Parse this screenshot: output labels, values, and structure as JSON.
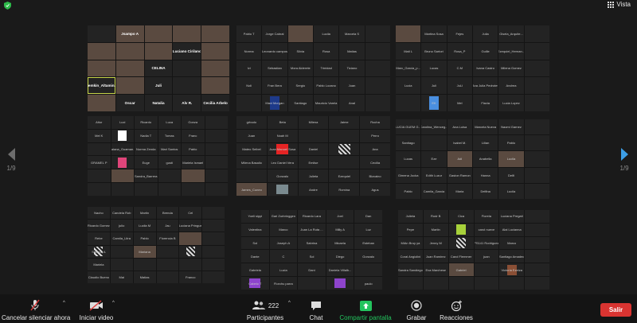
{
  "topbar": {
    "view_label": "Vista"
  },
  "nav": {
    "left_page": "1/9",
    "right_page": "1/9"
  },
  "colors": {
    "accent_blue": "#3d9ee6",
    "share_green": "#23c45e",
    "leave_red": "#d93431",
    "background": "#1a1a1a"
  },
  "panels": [
    {
      "cols": 5,
      "rows": 5,
      "cells": [
        "",
        "Jsampo A",
        "",
        "",
        "",
        "",
        "",
        "",
        "Luciano Cirilano",
        "",
        "",
        "",
        "CELINA",
        "",
        "",
        "Gemkin_Altamin...",
        "",
        "Juli",
        "",
        "",
        "",
        "Oscar",
        "Natalia",
        "Alv R.",
        "Cecilia Arbelo"
      ]
    },
    {
      "cols": 6,
      "rows": 5,
      "cells": [
        "Pablo T",
        "Jorge Cabral",
        "",
        "Lucila",
        "Marcela S",
        "",
        "Norma",
        "Leonardo campos",
        "Silvia",
        "Rosa",
        "Matias",
        "",
        "Ivi",
        "Sebastian",
        "Mora Alderete",
        "Trinidad",
        "Tiziano",
        "",
        "Noli",
        "Fran Bera",
        "Sergio",
        "Pablo Lozano",
        "Juan",
        "",
        "",
        "Maxi Morgan",
        "Santiago",
        "Mauricio Varela",
        "Anal",
        ""
      ]
    },
    {
      "cols": 6,
      "rows": 5,
      "cells": [
        "",
        "Martina Sosa",
        "Fejes",
        "Julia",
        "Gisela_Arquite...",
        "",
        "Mati L",
        "Bruno Sartori",
        "Rosa_P",
        "Guille",
        "Ezequiel_Hernan...",
        "",
        "Marc_Garcia_p...",
        "Lucas",
        "C.M",
        "Ivana Castro",
        "Milena Gomez",
        "",
        "Lucia",
        "Juli",
        "JuLi",
        "Ana Julia Pedrotes",
        "Andrea",
        "",
        "",
        "EK",
        "Mel",
        "Flavia",
        "Lucia Lopez",
        ""
      ]
    },
    {
      "cols": 6,
      "rows": 6,
      "cells": [
        "Aitor",
        "Luci",
        "Ricardo",
        "Luca",
        "Gonza",
        "",
        "Mel K",
        "",
        "Nadia T",
        "Tomas",
        "Franc",
        "",
        "",
        "Daiana_Guaman...",
        "Norma Zenda",
        "Mari Santos",
        "Pablo",
        "",
        "GRAMEL P",
        "",
        "Euge",
        "gusti",
        "Mariela Ismael",
        "",
        "",
        "",
        "Sandra_Barrera",
        "",
        "",
        "",
        "",
        "",
        "",
        "",
        "",
        ""
      ]
    },
    {
      "cols": 5,
      "rows": 6,
      "cells": [
        "grbodo",
        "Beta",
        "Milena",
        "Jaime",
        "Rocha",
        "Juan",
        "Noah M",
        "",
        "",
        "Perro",
        "Mateo Seibel",
        "Juan Manuel Sosa",
        "Daniel",
        "",
        "Ana",
        "Milena Basalio",
        "Leo Daniel Vera",
        "Emilse",
        "",
        "Cecilia",
        "",
        "Gonzalo",
        "Julieta",
        "Ezequiel",
        "Bizcaino",
        "James_Cuneo",
        "",
        "Andre",
        "Romina",
        "Agus"
      ]
    },
    {
      "cols": 6,
      "rows": 5,
      "cells": [
        "LUCIA GUEM G...",
        "Carolina_Wenceg...",
        "Ana Luisa",
        "Marcela Nueva",
        "Naomi Garnez",
        "",
        "Santiago",
        "",
        "Isabel M.",
        "Lilian",
        "Pablo",
        "",
        "Lucas",
        "Eze",
        "Adi",
        "Anabella",
        "Lucila",
        "",
        "Gimena Jocka",
        "Edith Luzur",
        "Gaston Ramon",
        "Hanna",
        "Delfi",
        "",
        "Pablo",
        "Camila_Garcia",
        "Maria",
        "Delfina",
        "Lucila",
        ""
      ]
    },
    {
      "cols": 6,
      "rows": 6,
      "cells": [
        "Nacho",
        "Candela Rob",
        "Martin",
        "Brenda",
        "Cel",
        "",
        "Ricardo Gomez",
        "julio",
        "Lucila M",
        "Jau",
        "Luciana Pringue",
        "",
        "Rebe",
        "Camila_Litra",
        "Pablo",
        "Florencia B",
        "",
        "",
        "Sabrina A",
        "",
        "Mariana",
        "",
        "",
        "",
        "Mariela",
        "",
        "",
        "",
        "",
        "",
        "Claudio Bueno",
        "Mai",
        "Matias",
        "",
        "Franco",
        ""
      ]
    },
    {
      "cols": 5,
      "rows": 6,
      "cells": [
        "Yoeli sippi",
        "Gari Zurbringgen",
        "Ricardo Lara",
        "Joel",
        "Dan",
        "Valentina",
        "Marco",
        "Juan La Ruta ...",
        "Milly A",
        "Luz",
        "Sol",
        "Joseph A",
        "Sabrina",
        "Micaela",
        "Esteban",
        "Dante",
        "C",
        "Sol",
        "Diego",
        "Gonzalo",
        "Gabriela",
        "Lucia",
        "Dani",
        "Daniela Villalb...",
        "",
        "Cabelo T",
        "Florchu parra",
        "",
        "",
        "paulo"
      ]
    },
    {
      "cols": 6,
      "rows": 6,
      "cells": [
        "Julieta",
        "Rodr B",
        "Cica",
        "Fiorela",
        "Luciana Pregati",
        "",
        "Pepe",
        "Martin",
        "",
        "carol nueve",
        "Alai Lucianna",
        "",
        "MiAn Bruy ya",
        "Jenny M",
        "",
        "PS141 Rodriguez",
        "Marco",
        "",
        "Coral Angiolini",
        "Juan Ramirez",
        "Carol Flemmer",
        "juan",
        "Santiago Amadeo",
        "",
        "Sandra Sandiego",
        "Eva Marchese",
        "Gabriel",
        "",
        "Victoria Ezeiza",
        "",
        "",
        "",
        "",
        "",
        "",
        ""
      ]
    }
  ],
  "toolbar": {
    "mute_label": "Cancelar silenciar ahora",
    "video_label": "Iniciar video",
    "participants_label": "Participantes",
    "participants_count": "222",
    "chat_label": "Chat",
    "share_label": "Compartir pantalla",
    "record_label": "Grabar",
    "reactions_label": "Reacciones",
    "leave_label": "Salir"
  }
}
